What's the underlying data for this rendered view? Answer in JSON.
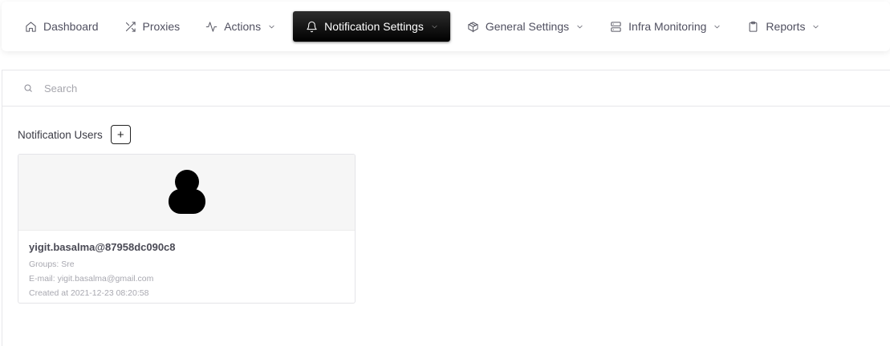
{
  "nav": {
    "items": [
      {
        "label": "Dashboard",
        "icon": "home-icon",
        "dropdown": false,
        "active": false
      },
      {
        "label": "Proxies",
        "icon": "shuffle-icon",
        "dropdown": false,
        "active": false
      },
      {
        "label": "Actions",
        "icon": "activity-icon",
        "dropdown": true,
        "active": false
      },
      {
        "label": "Notification Settings",
        "icon": "bell-icon",
        "dropdown": true,
        "active": true
      },
      {
        "label": "General Settings",
        "icon": "package-icon",
        "dropdown": true,
        "active": false
      },
      {
        "label": "Infra Monitoring",
        "icon": "server-icon",
        "dropdown": true,
        "active": false
      },
      {
        "label": "Reports",
        "icon": "clipboard-icon",
        "dropdown": true,
        "active": false
      }
    ]
  },
  "search": {
    "placeholder": "Search",
    "value": ""
  },
  "section": {
    "title": "Notification Users",
    "add_label": "+"
  },
  "users": [
    {
      "name": "yigit.basalma@87958dc090c8",
      "groups": "Groups: Sre",
      "email": "E-mail: yigit.basalma@gmail.com",
      "created": "Created at 2021-12-23 08:20:58"
    }
  ],
  "colors": {
    "active_bg": "#000000",
    "active_text": "#ffffff",
    "text": "#505060",
    "muted": "#a8a8b0"
  }
}
